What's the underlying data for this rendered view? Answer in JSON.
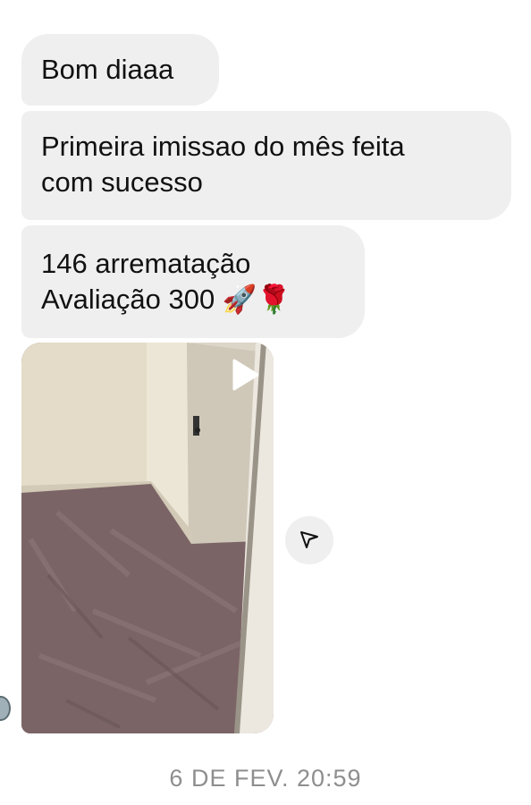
{
  "messages": [
    {
      "lines": [
        "Bom diaaa"
      ]
    },
    {
      "lines": [
        "Primeira imissao do mês feita",
        "com sucesso"
      ]
    },
    {
      "lines": [
        "146 arrematação",
        "Avaliação 300 🚀🌹"
      ]
    }
  ],
  "video": {
    "play_icon": "play-icon"
  },
  "share_icon": "send-icon",
  "timestamp": "6 DE FEV. 20:59",
  "colors": {
    "bubble": "#efefef",
    "text": "#111111",
    "timestamp": "#8e8e8e"
  }
}
